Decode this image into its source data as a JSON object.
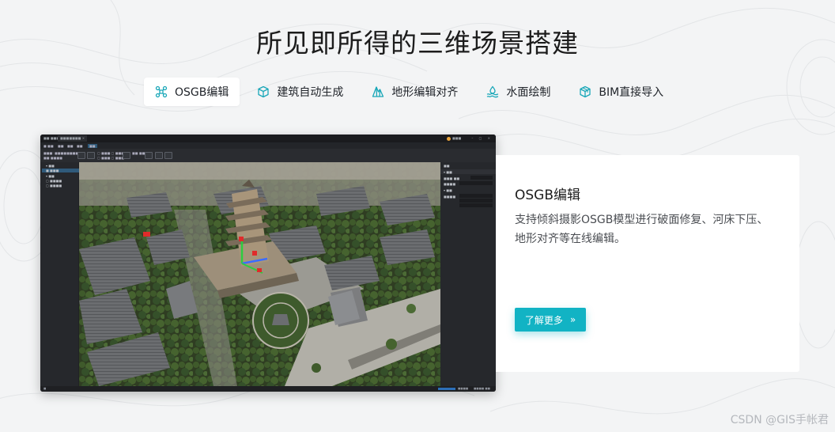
{
  "title": "所见即所得的三维场景搭建",
  "tabs": [
    {
      "label": "OSGB编辑",
      "icon": "drone-icon",
      "active": true
    },
    {
      "label": "建筑自动生成",
      "icon": "cube-icon",
      "active": false
    },
    {
      "label": "地形编辑对齐",
      "icon": "terrain-icon",
      "active": false
    },
    {
      "label": "水面绘制",
      "icon": "water-icon",
      "active": false
    },
    {
      "label": "BIM直接导入",
      "icon": "bim-cube-icon",
      "active": false
    }
  ],
  "card": {
    "title": "OSGB编辑",
    "description": "支持倾斜摄影OSGB模型进行破面修复、河床下压、地形对齐等在线编辑。",
    "button_label": "了解更多",
    "button_icon": "double-chevron-right-icon"
  },
  "watermark": "CSDN @GIS手帐君",
  "colors": {
    "accent": "#12b3c4",
    "background": "#f3f4f5",
    "icon_teal": "#19a7b8"
  }
}
